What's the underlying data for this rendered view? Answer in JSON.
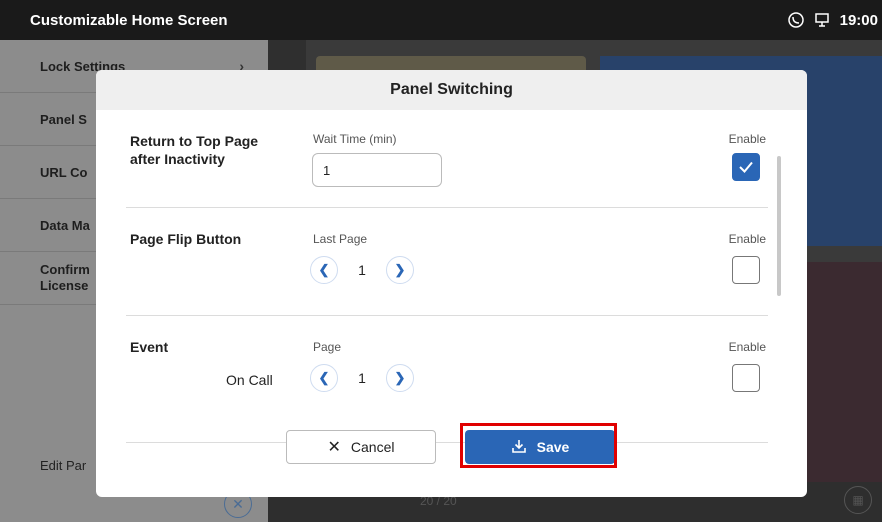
{
  "app": {
    "title": "Customizable Home Screen",
    "time": "19:00",
    "status_icons": [
      "call-icon",
      "monitor-icon"
    ]
  },
  "sidebar": {
    "items": [
      {
        "label": "Lock Settings"
      },
      {
        "label": "Panel S"
      },
      {
        "label": "URL Co"
      },
      {
        "label": "Data Ma"
      },
      {
        "label": "Confirm\nLicense"
      }
    ],
    "footer_label": "Edit Par"
  },
  "modal": {
    "title": "Panel Switching",
    "rows": [
      {
        "title": "Return to Top Page\nafter Inactivity",
        "field_label": "Wait Time (min)",
        "input_value": "1",
        "enable_label": "Enable",
        "enabled": true
      },
      {
        "title": "Page Flip Button",
        "field_label": "Last Page",
        "stepper_value": "1",
        "enable_label": "Enable",
        "enabled": false
      },
      {
        "title": "Event",
        "sub_label": "On Call",
        "field_label": "Page",
        "stepper_value": "1",
        "enable_label": "Enable",
        "enabled": false
      }
    ],
    "buttons": {
      "cancel_label": "Cancel",
      "save_label": "Save"
    }
  },
  "background": {
    "pager_text": "20 / 20"
  },
  "colors": {
    "accent": "#2a66b6",
    "highlight": "#e00000"
  }
}
